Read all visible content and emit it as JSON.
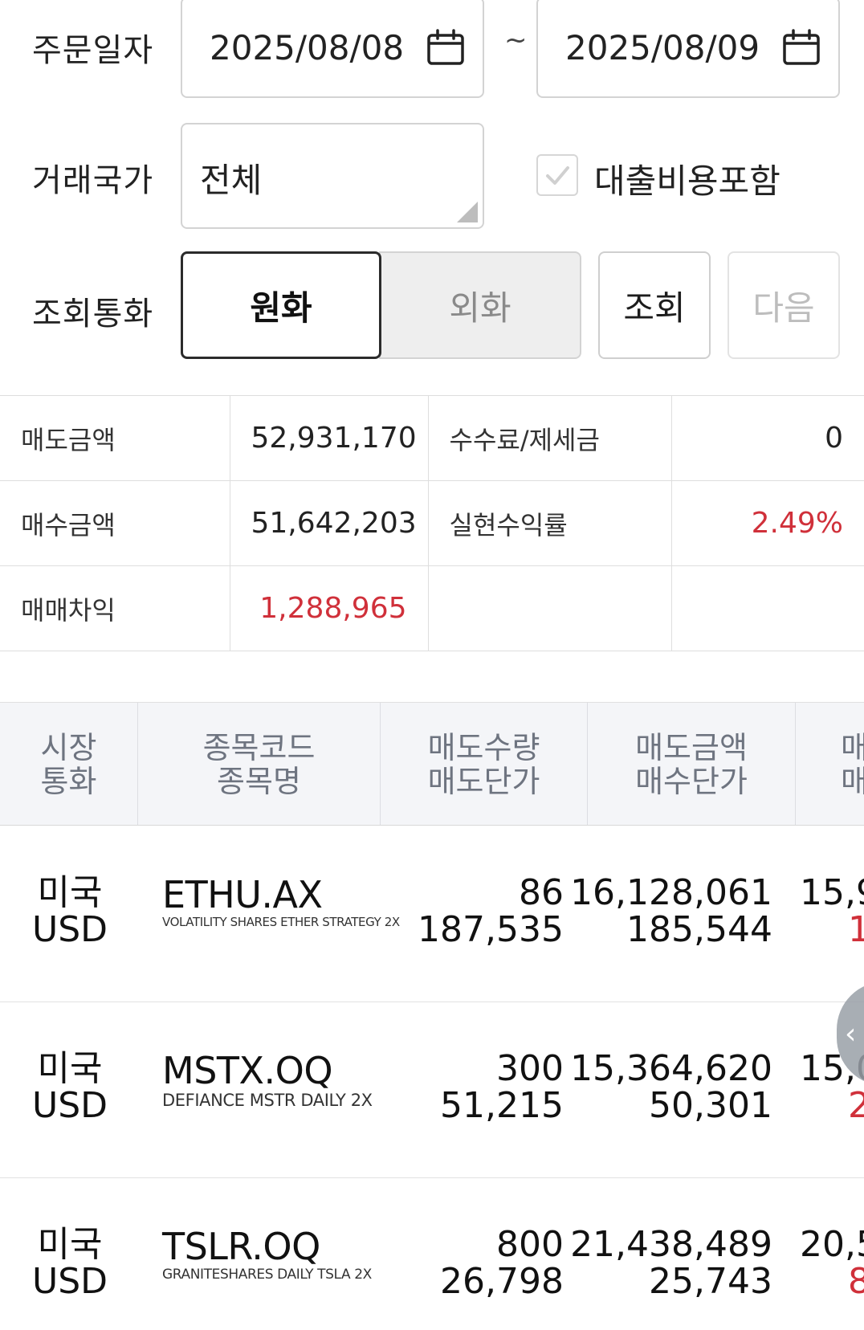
{
  "filters": {
    "order_date": {
      "label": "주문일자",
      "from": "2025/08/08",
      "separator": "~",
      "to": "2025/08/09",
      "icon": "calendar-icon"
    },
    "country": {
      "label": "거래국가",
      "value": "전체"
    },
    "include_loan_cost": {
      "label": "대출비용포함",
      "checked": true
    },
    "currency": {
      "label": "조회통화",
      "options": [
        "원화",
        "외화"
      ],
      "selected": "원화"
    },
    "buttons": {
      "query": "조회",
      "next": "다음"
    }
  },
  "summary": {
    "rows": [
      {
        "label1": "매도금액",
        "value1": "52,931,170",
        "label2": "수수료/제세금",
        "value2": "0"
      },
      {
        "label1": "매수금액",
        "value1": "51,642,203",
        "label2": "실현수익률",
        "value2": "2.49%"
      },
      {
        "label1": "매매차익",
        "value1": "1,288,965",
        "label2": "",
        "value2": ""
      }
    ],
    "positive_color": "#d0303a"
  },
  "table": {
    "headers": [
      {
        "line1": "시장",
        "line2": "통화"
      },
      {
        "line1": "종목코드",
        "line2": "종목명"
      },
      {
        "line1": "매도수량",
        "line2": "매도단가"
      },
      {
        "line1": "매도금액",
        "line2": "매수단가"
      },
      {
        "line1": "매",
        "line2": "매"
      }
    ],
    "rows": [
      {
        "market": "미국",
        "currency": "USD",
        "code": "ETHU.AX",
        "name": "VOLATILITY SHARES ETHER STRATEGY 2X",
        "sell_qty": "86",
        "sell_price": "187,535",
        "sell_amount": "16,128,061",
        "buy_price": "185,544",
        "cut_top": "15,9",
        "cut_bottom": "1"
      },
      {
        "market": "미국",
        "currency": "USD",
        "code": "MSTX.OQ",
        "name": "DEFIANCE MSTR DAILY 2X",
        "sell_qty": "300",
        "sell_price": "51,215",
        "sell_amount": "15,364,620",
        "buy_price": "50,301",
        "cut_top": "15,0",
        "cut_bottom": "2"
      },
      {
        "market": "미국",
        "currency": "USD",
        "code": "TSLR.OQ",
        "name": "GRANITESHARES DAILY TSLA 2X",
        "sell_qty": "800",
        "sell_price": "26,798",
        "sell_amount": "21,438,489",
        "buy_price": "25,743",
        "cut_top": "20,5",
        "cut_bottom": "8"
      }
    ]
  },
  "side_handle_icon": "chevron-left-icon"
}
